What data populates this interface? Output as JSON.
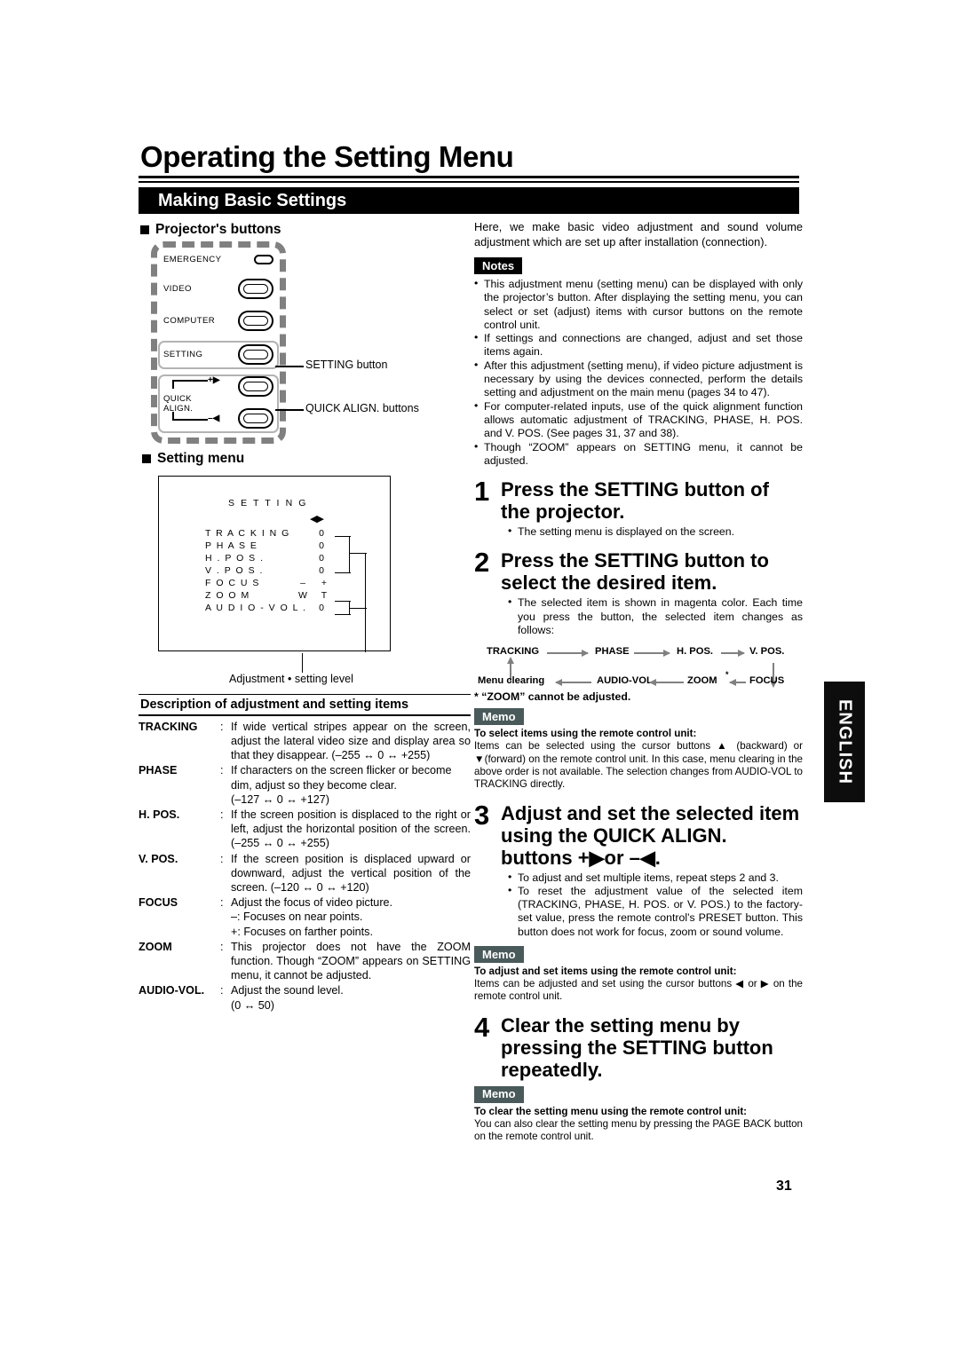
{
  "document": {
    "title": "Operating the Setting Menu",
    "section_bar": "Making Basic Settings",
    "page_number": "31",
    "side_tab": "ENGLISH"
  },
  "left_column": {
    "projector_buttons": {
      "heading": "Projector's buttons",
      "labels": [
        "EMERGENCY",
        "VIDEO",
        "COMPUTER",
        "SETTING"
      ],
      "quick_align_label_line1": "QUICK",
      "quick_align_label_line2": "ALIGN.",
      "plus_symbol": "+▶",
      "minus_symbol": "–◀",
      "callout_setting": "SETTING button",
      "callout_quick_align": "QUICK ALIGN. buttons"
    },
    "setting_menu": {
      "heading": "Setting menu",
      "screen_title": "S E T T I N G",
      "cursor_arrows": "◀▶",
      "items": [
        "T R A C K I N G",
        "P H A S E",
        "H . P O S .",
        "V . P O S .",
        "F O C U S",
        "Z O O M",
        "A U D I O  - V O L ."
      ],
      "values": [
        "0",
        "0",
        "0",
        "0",
        "– +",
        "W T",
        "0"
      ],
      "focus_minus": "–",
      "focus_plus": "+",
      "zoom_w": "W",
      "zoom_t": "T",
      "caption": "Adjustment • setting level"
    },
    "description": {
      "heading": "Description of adjustment and setting items",
      "rows": [
        {
          "term": "TRACKING",
          "colon": ":",
          "body": "If wide vertical stripes appear on the screen, adjust the lateral video size and display area so that they disappear. (–255 ↔ 0 ↔ +255)"
        },
        {
          "term": "PHASE",
          "colon": ":",
          "body": "If characters on the screen flicker or become dim, adjust so they become clear.",
          "body2": "(–127 ↔ 0 ↔ +127)"
        },
        {
          "term": "H. POS.",
          "colon": ":",
          "body": "If the screen position is displaced to the right or left, adjust the horizontal position of the screen. (–255 ↔ 0 ↔ +255)"
        },
        {
          "term": "V. POS.",
          "colon": ":",
          "body": "If the screen position is displaced upward or downward, adjust the vertical position of the screen. (–120 ↔ 0 ↔ +120)"
        },
        {
          "term": "FOCUS",
          "colon": ":",
          "body": "Adjust the focus of video picture.",
          "body2": "–: Focuses on near points.",
          "body3": "+: Focuses on farther points."
        },
        {
          "term": "ZOOM",
          "colon": ":",
          "body": "This projector does not have the ZOOM function. Though “ZOOM” appears on SETTING menu, it cannot be adjusted."
        },
        {
          "term": "AUDIO-VOL.",
          "colon": ":",
          "body": "Adjust the sound level.",
          "body2": "(0 ↔ 50)"
        }
      ]
    }
  },
  "right_column": {
    "intro": "Here, we make basic video adjustment and sound volume adjustment which are set up after installation (connection).",
    "notes_tag": "Notes",
    "notes": [
      "This adjustment menu (setting menu) can be displayed with only the projector’s button. After displaying the setting menu, you can select or set (adjust) items with cursor buttons on the remote control unit.",
      "If settings and connections are changed, adjust and set those items again.",
      "After this adjustment (setting menu), if video picture adjustment is necessary by using the devices connected, perform the details setting and adjustment on the main menu (pages 34 to 47).",
      "For computer-related inputs, use of the quick alignment function allows automatic adjustment of TRACKING, PHASE, H. POS. and V. POS. (See pages 31, 37 and 38).",
      "Though “ZOOM” appears on SETTING menu, it cannot be adjusted."
    ],
    "steps": [
      {
        "num": "1",
        "title": "Press the SETTING button of the projector.",
        "bullets": [
          "The setting menu is displayed on the screen."
        ]
      },
      {
        "num": "2",
        "title": "Press the SETTING button to select the desired item.",
        "bullets": [
          "The selected item is shown in magenta color. Each time you press the button, the selected item changes as follows:"
        ]
      },
      {
        "num": "3",
        "title": "Adjust and set the selected item using the QUICK ALIGN. buttons +▶or –◀.",
        "bullets": [
          "To adjust and set multiple items, repeat steps 2 and 3.",
          "To reset the adjustment value of the selected item (TRACKING, PHASE, H. POS. or V. POS.) to the factory-set value, press the remote control’s PRESET button. This button does not work for focus, zoom or sound volume."
        ]
      },
      {
        "num": "4",
        "title": "Clear the setting menu by pressing the SETTING button repeatedly.",
        "bullets": []
      }
    ],
    "flow": {
      "top_row": [
        "TRACKING",
        "PHASE",
        "H. POS.",
        "V. POS."
      ],
      "bottom_row": [
        "Menu clearing",
        "AUDIO-VOL.",
        "ZOOM",
        "FOCUS"
      ],
      "zoom_asterisk": "*",
      "footnote": "*  “ZOOM” cannot be adjusted."
    },
    "memos": [
      {
        "tag": "Memo",
        "lead": "To select items using the remote control unit:",
        "body": "Items can be selected using the cursor buttons ▲  (backward) or ▼(forward) on the remote control unit. In this case, menu clearing in the above order is not available. The selection changes from AUDIO-VOL to TRACKING directly."
      },
      {
        "tag": "Memo",
        "lead": "To adjust and set items using the remote control unit:",
        "body": "Items can be adjusted and set using the cursor buttons ◀ or ▶ on the remote control unit."
      },
      {
        "tag": "Memo",
        "lead": "To clear the setting menu using the remote control unit:",
        "body": "You can also clear the setting menu by pressing the PAGE BACK button on the remote control unit."
      }
    ]
  }
}
